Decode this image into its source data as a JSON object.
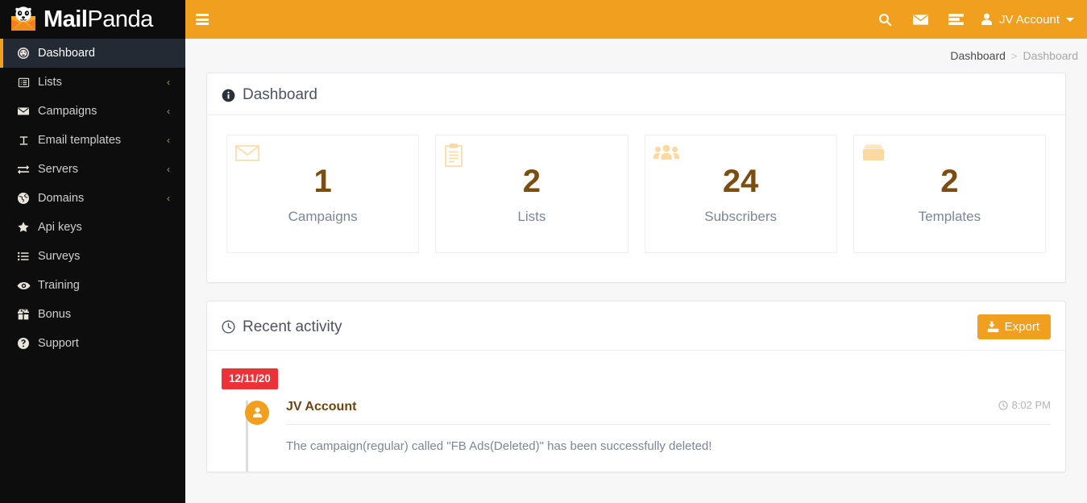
{
  "brand": {
    "bold": "Mail",
    "light": "Panda",
    "logo_icon": "panda-envelope-logo"
  },
  "sidebar": {
    "items": [
      {
        "label": "Dashboard",
        "icon": "tachometer-icon",
        "active": true,
        "caret": ""
      },
      {
        "label": "Lists",
        "icon": "list-alt-icon",
        "active": false,
        "caret": "‹"
      },
      {
        "label": "Campaigns",
        "icon": "envelope-icon",
        "active": false,
        "caret": "‹"
      },
      {
        "label": "Email templates",
        "icon": "text-height-icon",
        "active": false,
        "caret": "‹"
      },
      {
        "label": "Servers",
        "icon": "exchange-icon",
        "active": false,
        "caret": "‹"
      },
      {
        "label": "Domains",
        "icon": "globe-icon",
        "active": false,
        "caret": "‹"
      },
      {
        "label": "Api keys",
        "icon": "star-icon",
        "active": false,
        "caret": ""
      },
      {
        "label": "Surveys",
        "icon": "list-ul-icon",
        "active": false,
        "caret": ""
      },
      {
        "label": "Training",
        "icon": "eye-icon",
        "active": false,
        "caret": ""
      },
      {
        "label": "Bonus",
        "icon": "gift-icon",
        "active": false,
        "caret": ""
      },
      {
        "label": "Support",
        "icon": "question-circle-icon",
        "active": false,
        "caret": ""
      }
    ]
  },
  "topbar": {
    "menu_icon": "hamburger-icon",
    "search_icon": "search-icon",
    "messages_icon": "envelope-icon",
    "tasks_icon": "tasks-icon",
    "user_icon": "user-icon",
    "user_name": "JV Account"
  },
  "breadcrumb": {
    "parent": "Dashboard",
    "separator": ">",
    "current": "Dashboard"
  },
  "dashboard_panel": {
    "icon": "info-circle-icon",
    "title": "Dashboard",
    "stats": [
      {
        "icon": "envelope-o-icon",
        "value": "1",
        "label": "Campaigns"
      },
      {
        "icon": "clipboard-list-icon",
        "value": "2",
        "label": "Lists"
      },
      {
        "icon": "users-icon",
        "value": "24",
        "label": "Subscribers"
      },
      {
        "icon": "folder-icon",
        "value": "2",
        "label": "Templates"
      }
    ]
  },
  "activity_panel": {
    "icon": "clock-icon",
    "title": "Recent activity",
    "export_label": "Export",
    "export_icon": "export-icon",
    "date_badge": "12/11/20",
    "entries": [
      {
        "avatar_icon": "user-icon",
        "user": "JV Account",
        "time_icon": "clock-icon",
        "time": "8:02 PM",
        "text": "The campaign(regular) called \"FB Ads(Deleted)\" has been successfully deleted!"
      }
    ]
  },
  "colors": {
    "brand_orange": "#f0a01e",
    "sidebar_bg": "#0d0d0d",
    "sidebar_active_bg": "#232a33",
    "stat_number": "#7a4e11",
    "date_badge_red": "#ec3237",
    "page_bg": "#f7f7f7"
  }
}
